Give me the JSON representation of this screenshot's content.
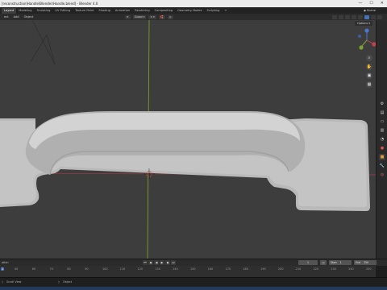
{
  "window": {
    "title": "[reconstruction\\Handle\\Blender\\Handle.blend] - Blender 4.0",
    "controls": [
      "—",
      "☐",
      "✕"
    ]
  },
  "workspace_tabs": [
    {
      "label": "Layout",
      "active": true
    },
    {
      "label": "Modeling",
      "active": false
    },
    {
      "label": "Sculpting",
      "active": false
    },
    {
      "label": "UV Editing",
      "active": false
    },
    {
      "label": "Texture Paint",
      "active": false
    },
    {
      "label": "Shading",
      "active": false
    },
    {
      "label": "Animation",
      "active": false
    },
    {
      "label": "Rendering",
      "active": false
    },
    {
      "label": "Compositing",
      "active": false
    },
    {
      "label": "Geometry Nodes",
      "active": false
    },
    {
      "label": "Scripting",
      "active": false
    },
    {
      "label": "+",
      "active": false
    }
  ],
  "scene": {
    "label": "Scene"
  },
  "header": {
    "menus": [
      "ect",
      "Add",
      "Object"
    ],
    "orientation": "Global",
    "options_label": "Options"
  },
  "timeline": {
    "playback_label": "ation",
    "current_frame": "1",
    "start_label": "Start",
    "start_value": "1",
    "end_label": "End",
    "end_value": "250",
    "ruler_ticks": [
      "40",
      "60",
      "70",
      "80",
      "90",
      "100",
      "110",
      "120",
      "130",
      "140",
      "150",
      "160",
      "170",
      "180",
      "190",
      "200",
      "210",
      "220",
      "230",
      "240",
      "250"
    ],
    "ruler_current": "1"
  },
  "status": {
    "left_label": "Scroll View",
    "middle_label": "Object"
  },
  "colors": {
    "accent": "#4772b3",
    "viewport_bg": "#3d3d3d",
    "x_axis": "#b33447",
    "y_axis": "#7d9b2a",
    "mesh": "#c9c9c9"
  }
}
